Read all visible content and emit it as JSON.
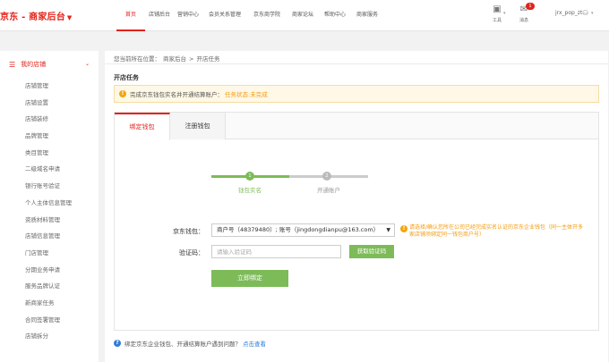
{
  "header": {
    "brand": "京东 - 商家后台",
    "brand_caret": "▼",
    "nav": [
      {
        "label": "首页",
        "active": true
      },
      {
        "label": "店铺后台",
        "active": false
      },
      {
        "label": "营销中心",
        "active": false
      },
      {
        "label": "会员关系管理",
        "active": false
      },
      {
        "label": "京东商学院",
        "active": false
      },
      {
        "label": "商家论坛",
        "active": false
      },
      {
        "label": "帮助中心",
        "active": false
      },
      {
        "label": "商家服务",
        "active": false
      }
    ],
    "tools": {
      "tool1_label": "工具",
      "msg_label": "消息",
      "msg_badge": "1"
    },
    "username": "jrx_pop_zt..."
  },
  "sidebar": {
    "head": "我的店铺",
    "items": [
      "店铺管理",
      "店铺设置",
      "店铺装修",
      "品牌管理",
      "类目管理",
      "二级域名申请",
      "银行账号验证",
      "个人主体信息管理",
      "资质材料管理",
      "店铺信息管理",
      "门店管理",
      "分期业务申请",
      "服务品牌认证",
      "新商家任务",
      "合同签署管理",
      "店铺拆分"
    ]
  },
  "main": {
    "breadcrumb": {
      "prefix": "您当前所在位置：",
      "level1": "商家后台",
      "sep": ">",
      "level2": "开店任务"
    },
    "section_title": "开店任务",
    "notice": {
      "text": "完成京东钱包实名并开通结算账户：",
      "status": "任务状态:未完成"
    },
    "tabs": [
      {
        "label": "绑定钱包",
        "active": true
      },
      {
        "label": "注册钱包",
        "active": false
      }
    ],
    "steps": [
      {
        "num": "1",
        "label": "钱包实名"
      },
      {
        "num": "2",
        "label": "开通账户"
      }
    ],
    "form": {
      "wallet_label": "京东钱包：",
      "wallet_value": "商户号（48379480）; 账号（jingdongdianpu@163.com）",
      "hint": "请选择/确认您所在公司已经完成实名认证的京东企业钱包（同一主体开多家店铺须绑定同一钱包商户号）",
      "code_label": "验证码：",
      "code_placeholder": "请输入验证码",
      "get_code": "获取验证码",
      "submit": "立即绑定"
    },
    "help": {
      "text": "绑定京东企业钱包、开通结算账户遇到问题？",
      "link": "点击查看"
    }
  }
}
